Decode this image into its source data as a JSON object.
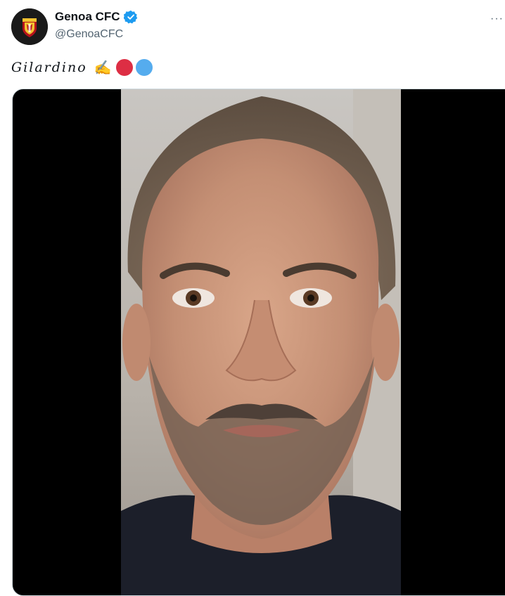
{
  "account": {
    "display_name": "Genoa CFC",
    "handle": "@GenoaCFC",
    "verified": true,
    "avatar_icon": "genoa-crest-icon"
  },
  "menu": {
    "more_label": "···"
  },
  "tweet": {
    "text": "Gilardino",
    "emoji": [
      "writing-hand",
      "red-circle",
      "blue-circle"
    ]
  },
  "media": {
    "type": "video",
    "content": "portrait-of-man-with-beard"
  },
  "colors": {
    "verified_blue": "#1d9bf0",
    "red_circle": "#dd2e44",
    "blue_circle": "#55acee",
    "text_primary": "#0f1419",
    "text_secondary": "#536471"
  }
}
